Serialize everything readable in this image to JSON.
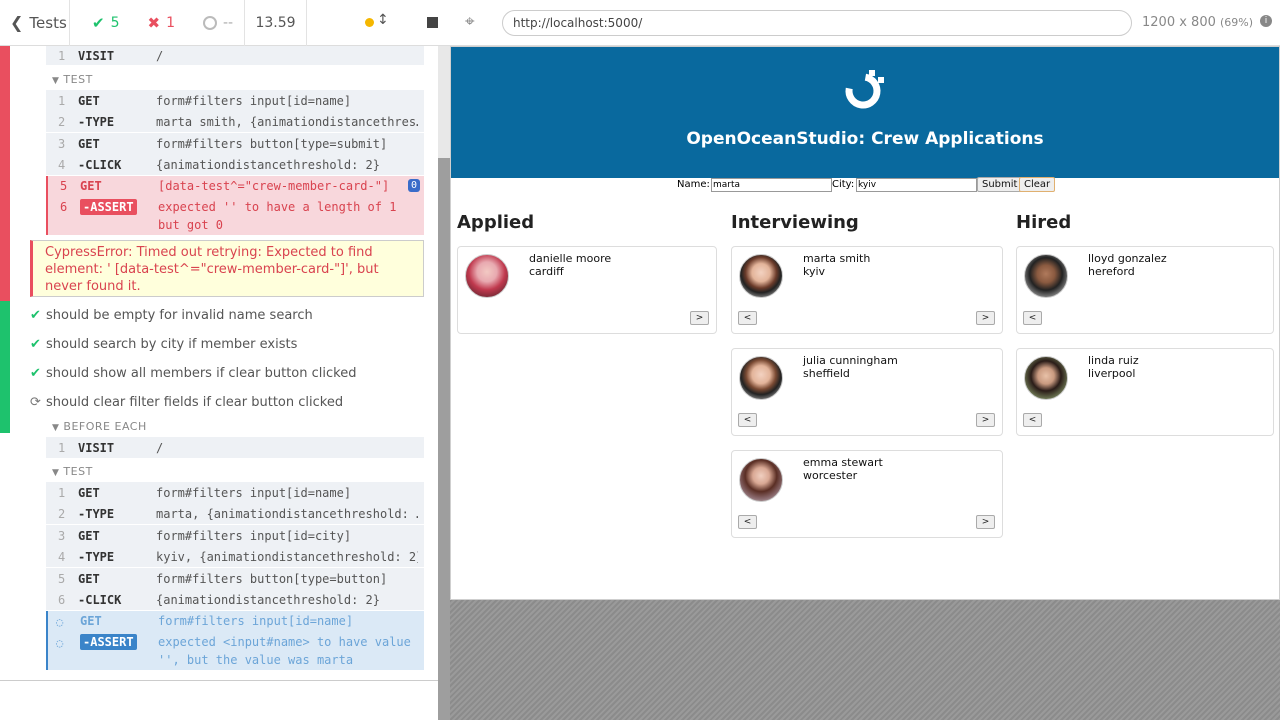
{
  "runner": {
    "tests_label": "Tests",
    "passed": "5",
    "failed": "1",
    "pending": "--",
    "duration": "13.59",
    "colors": {
      "pass": "#1ec26d",
      "fail": "#e94f5f",
      "pending_blue": "#3a84c9"
    }
  },
  "suite": {
    "top_row": {
      "num": "1",
      "name": "VISIT",
      "msg": "/"
    },
    "test_label": "TEST",
    "failing_commands": [
      {
        "num": "1",
        "name": "GET",
        "msg": "form#filters input[id=name]"
      },
      {
        "num": "2",
        "name": "-TYPE",
        "msg": "marta smith, {animationdistancethres…"
      },
      {
        "num": "3",
        "name": "GET",
        "msg": "form#filters button[type=submit]"
      },
      {
        "num": "4",
        "name": "-CLICK",
        "msg": "{animationdistancethreshold: 2}"
      },
      {
        "num": "5",
        "name": "GET",
        "msg": "[data-test^=\"crew-member-card-\"]",
        "badge": "0"
      },
      {
        "num": "6",
        "name": "-ASSERT",
        "msg1": "expected '' to have a length of 1",
        "msg2": "but got 0"
      }
    ],
    "error": "CypressError: Timed out retrying: Expected to find element: ' [data-test^=\"crew-member-card-\"]', but never found it.",
    "tests": [
      {
        "title": "should be empty for invalid name search",
        "state": "passed"
      },
      {
        "title": "should search by city if member exists",
        "state": "passed"
      },
      {
        "title": "should show all members if clear button clicked",
        "state": "passed"
      },
      {
        "title": "should clear filter fields if clear button clicked",
        "state": "running"
      }
    ],
    "before_each_label": "BEFORE EACH",
    "before_each": {
      "num": "1",
      "name": "VISIT",
      "msg": "/"
    },
    "test_label_2": "TEST",
    "running_commands": [
      {
        "num": "1",
        "name": "GET",
        "msg": "form#filters input[id=name]"
      },
      {
        "num": "2",
        "name": "-TYPE",
        "msg": "marta, {animationdistancethreshold: …"
      },
      {
        "num": "3",
        "name": "GET",
        "msg": "form#filters input[id=city]"
      },
      {
        "num": "4",
        "name": "-TYPE",
        "msg": "kyiv, {animationdistancethreshold: 2}"
      },
      {
        "num": "5",
        "name": "GET",
        "msg": "form#filters button[type=button]"
      },
      {
        "num": "6",
        "name": "-CLICK",
        "msg": "{animationdistancethreshold: 2}"
      },
      {
        "num": "",
        "name": "GET",
        "msg": "form#filters input[id=name]"
      },
      {
        "num": "",
        "name": "-ASSERT",
        "msg1": "expected <input#name> to have value",
        "msg2": "'', but the value was marta"
      }
    ]
  },
  "browser": {
    "url": "http://localhost:5000/",
    "viewport": "1200 x 800",
    "scale": "(69%)"
  },
  "app": {
    "title": "OpenOceanStudio: Crew Applications",
    "header_color": "#09699e",
    "filters": {
      "name_label": "Name:",
      "name_value": "marta",
      "city_label": "City:",
      "city_value": "kyiv",
      "submit": "Submit",
      "clear": "Clear"
    },
    "columns": [
      {
        "title": "Applied",
        "cards": [
          {
            "name": "danielle moore",
            "city": "cardiff"
          }
        ]
      },
      {
        "title": "Interviewing",
        "cards": [
          {
            "name": "marta smith",
            "city": "kyiv"
          },
          {
            "name": "julia cunningham",
            "city": "sheffield"
          },
          {
            "name": "emma stewart",
            "city": "worcester"
          }
        ]
      },
      {
        "title": "Hired",
        "cards": [
          {
            "name": "lloyd gonzalez",
            "city": "hereford"
          },
          {
            "name": "linda ruiz",
            "city": "liverpool"
          }
        ]
      }
    ],
    "prev_label": "<",
    "next_label": ">"
  }
}
